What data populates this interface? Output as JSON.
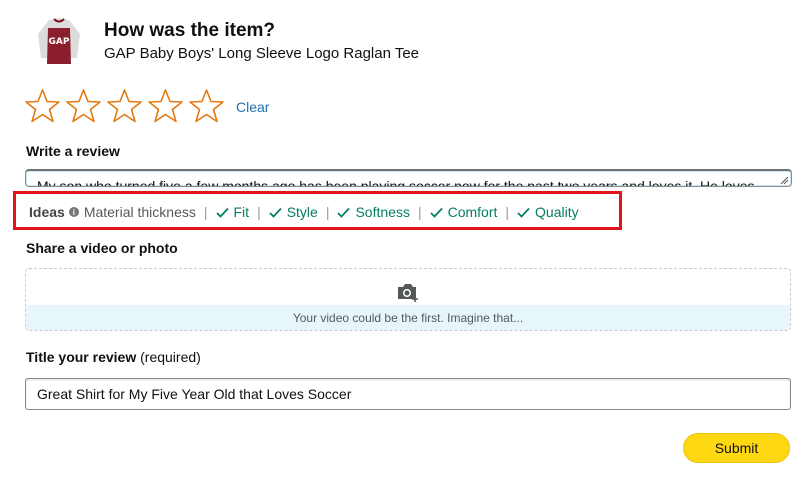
{
  "product": {
    "heading": "How was the item?",
    "name": "GAP Baby Boys' Long Sleeve Logo Raglan Tee",
    "image_icon": "raglan-tee-thumbnail"
  },
  "rating": {
    "max_stars": 5,
    "selected": 0,
    "star_color": "#e47911",
    "clear_label": "Clear"
  },
  "review": {
    "label": "Write a review",
    "text": "My son who turned five a few months ago has been playing soccer now for the past two years and loves it. He loves"
  },
  "ideas": {
    "title": "Ideas",
    "info_icon": "info-icon",
    "first": "Material thickness",
    "chips": [
      "Fit",
      "Style",
      "Softness",
      "Comfort",
      "Quality"
    ],
    "highlight_color": "#e3131a",
    "chip_color": "#067d62"
  },
  "media": {
    "label": "Share a video or photo",
    "caption": "Your video could be the first. Imagine that...",
    "icon": "camera-add-icon"
  },
  "title": {
    "label": "Title your review",
    "suffix": "(required)",
    "value": "Great Shirt for My Five Year Old that Loves Soccer"
  },
  "submit": {
    "label": "Submit",
    "color": "#ffd814"
  }
}
